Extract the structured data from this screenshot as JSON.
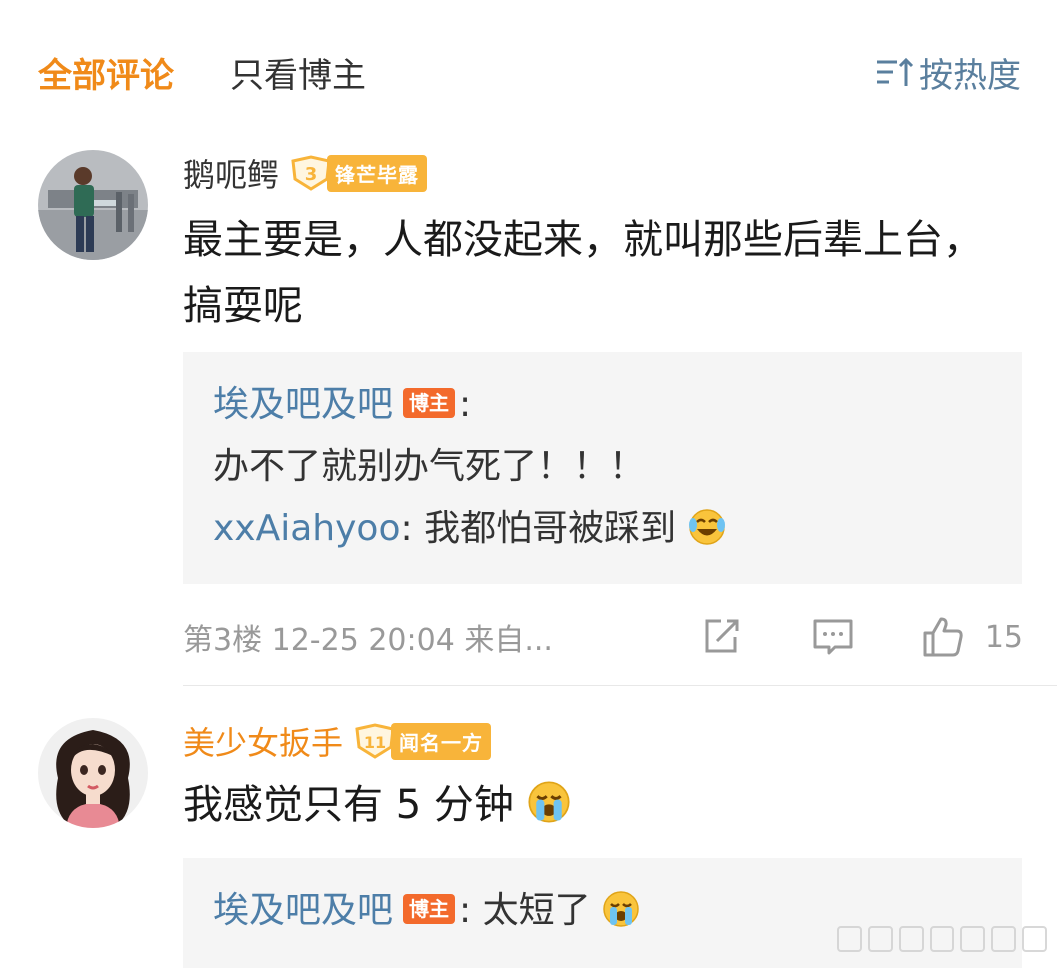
{
  "tabs": {
    "all": "全部评论",
    "blogger_only": "只看博主",
    "sort": "按热度"
  },
  "icons": {
    "sort": "sort-icon",
    "share": "share-icon",
    "comment": "comment-icon",
    "like": "thumbs-up-icon",
    "laugh_cry": "laugh-cry-emoji",
    "crying": "crying-emoji"
  },
  "colors": {
    "accent": "#f08a19",
    "link": "#4d7ea8",
    "blogger_tag": "#f36a2c",
    "level_badge": "#f8b43a"
  },
  "comments": [
    {
      "username": "鹅呃鳄",
      "level": "3",
      "level_title": "锋芒毕露",
      "text": "最主要是，人都没起来，就叫那些后辈上台，搞耍呢",
      "replies": [
        {
          "name": "埃及吧及吧",
          "tag": "博主",
          "text": "办不了就别办气死了！！！"
        },
        {
          "name": "xxAiahyoo",
          "text": "我都怕哥被踩到"
        }
      ],
      "meta": "第3楼 12-25 20:04 来自...",
      "likes": "15"
    },
    {
      "username": "美少女扳手",
      "level": "11",
      "level_title": "闻名一方",
      "text": "我感觉只有 5 分钟",
      "replies": [
        {
          "name": "埃及吧及吧",
          "tag": "博主",
          "text": "太短了"
        }
      ]
    }
  ]
}
